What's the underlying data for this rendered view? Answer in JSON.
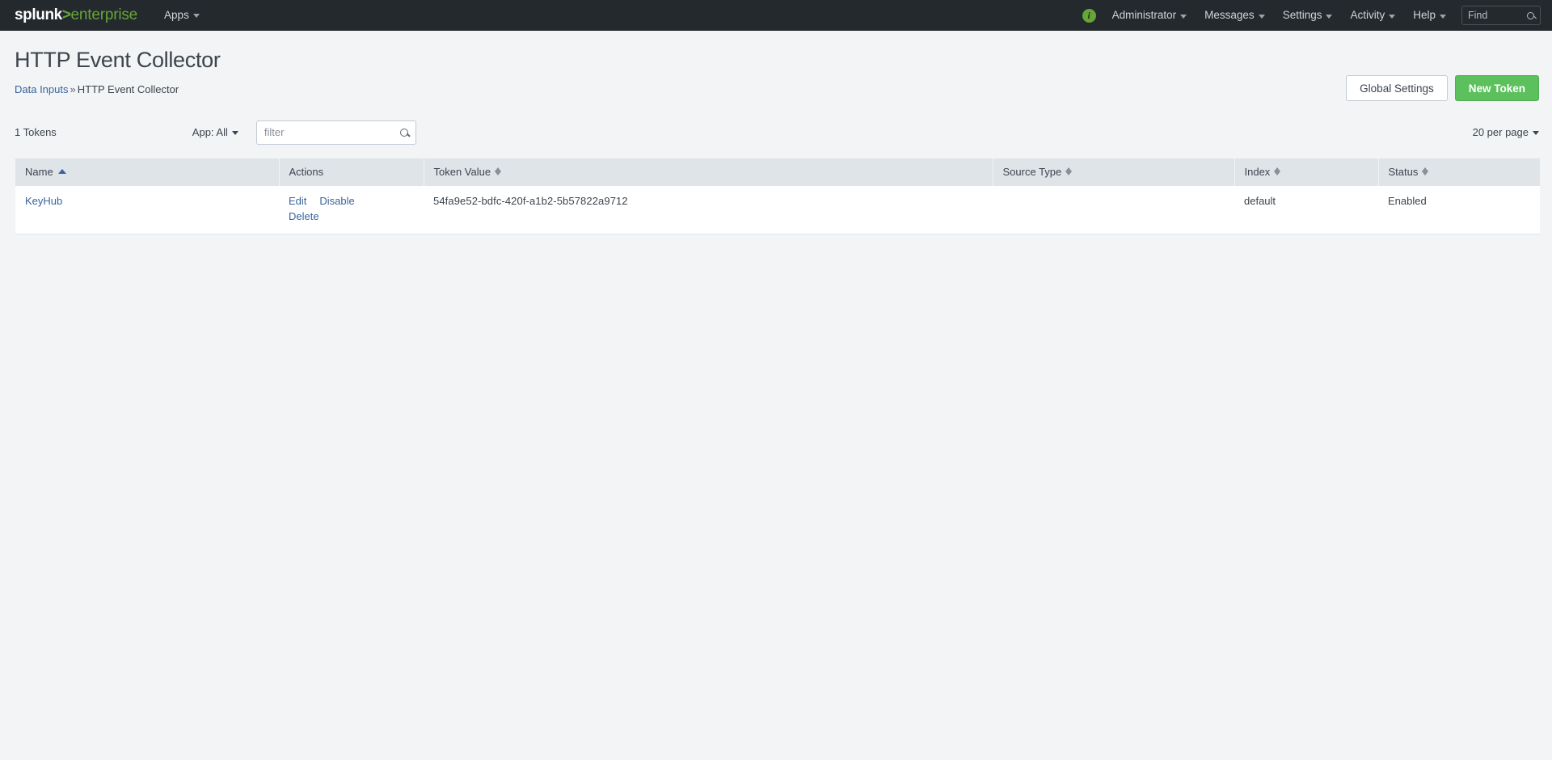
{
  "topnav": {
    "logo": {
      "brand": "splunk",
      "gt": ">",
      "product": "enterprise"
    },
    "apps_label": "Apps",
    "info_icon_label": "i",
    "items": [
      {
        "label": "Administrator",
        "name": "administrator"
      },
      {
        "label": "Messages",
        "name": "messages"
      },
      {
        "label": "Settings",
        "name": "settings"
      },
      {
        "label": "Activity",
        "name": "activity"
      },
      {
        "label": "Help",
        "name": "help"
      }
    ],
    "find": {
      "placeholder": "Find",
      "value": ""
    }
  },
  "page": {
    "title": "HTTP Event Collector",
    "breadcrumb": {
      "parent": "Data Inputs",
      "separator": "»",
      "current": "HTTP Event Collector"
    },
    "buttons": {
      "global_settings": "Global Settings",
      "new_token": "New Token"
    }
  },
  "filterbar": {
    "count_label": "1 Tokens",
    "app_filter_label": "App: All",
    "filter_placeholder": "filter",
    "filter_value": "",
    "per_page_label": "20 per page"
  },
  "table": {
    "columns": [
      {
        "label": "Name",
        "sort": "asc"
      },
      {
        "label": "Actions",
        "sort": "none"
      },
      {
        "label": "Token Value",
        "sort": "both"
      },
      {
        "label": "Source Type",
        "sort": "both"
      },
      {
        "label": "Index",
        "sort": "both"
      },
      {
        "label": "Status",
        "sort": "both"
      }
    ],
    "rows": [
      {
        "name": "KeyHub",
        "actions": {
          "edit": "Edit",
          "disable": "Disable",
          "delete": "Delete"
        },
        "token_value": "54fa9e52-bdfc-420f-a1b2-5b57822a9712",
        "source_type": "",
        "index": "default",
        "status": "Enabled"
      }
    ]
  },
  "colors": {
    "brand_green": "#65a637",
    "primary_button": "#5cc05c",
    "link": "#3863a0",
    "topbar": "#24292e",
    "page_bg": "#f2f4f5",
    "table_header": "#dfe4e8"
  }
}
